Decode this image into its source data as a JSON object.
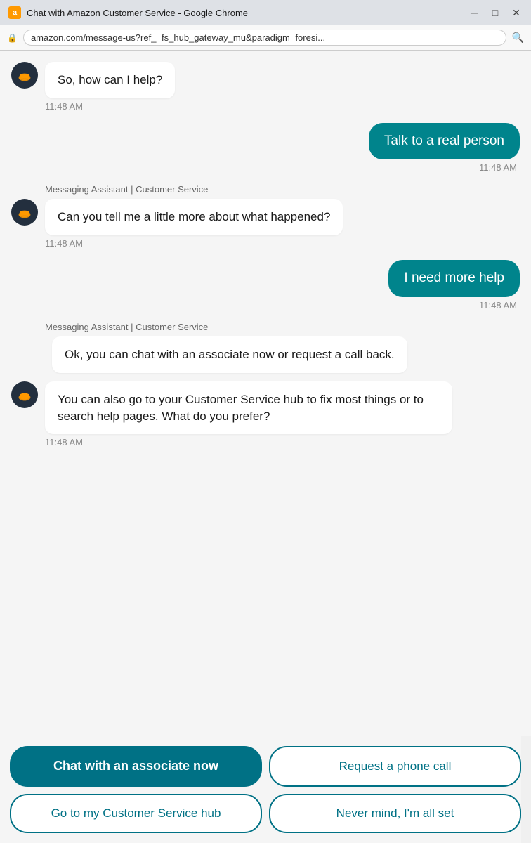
{
  "window": {
    "title": "Chat with Amazon Customer Service - Google Chrome",
    "url": "amazon.com/message-us?ref_=fs_hub_gateway_mu&paradigm=foresi..."
  },
  "titlebar": {
    "icon_label": "a",
    "minimize": "─",
    "maximize": "□",
    "close": "✕"
  },
  "messages": [
    {
      "id": "msg1",
      "type": "bot",
      "text": "So, how can I help?",
      "timestamp": "11:48 AM",
      "show_avatar": true,
      "show_assistant_label": false
    },
    {
      "id": "msg2",
      "type": "user",
      "text": "Talk to a real person",
      "timestamp": "11:48 AM"
    },
    {
      "id": "msg3",
      "type": "bot",
      "text": "Can you tell me a little more about what happened?",
      "timestamp": "11:48 AM",
      "show_avatar": true,
      "show_assistant_label": true,
      "assistant_label": "Messaging Assistant | Customer Service"
    },
    {
      "id": "msg4",
      "type": "user",
      "text": "I need more help",
      "timestamp": "11:48 AM"
    },
    {
      "id": "msg5",
      "type": "bot_multi",
      "bubbles": [
        "Ok, you can chat with an associate now or request a call back.",
        "You can also go to your Customer Service hub to fix most things or to search help pages. What do you prefer?"
      ],
      "timestamp": "11:48 AM",
      "show_avatar": true,
      "show_assistant_label": true,
      "assistant_label": "Messaging Assistant | Customer Service"
    }
  ],
  "buttons": [
    {
      "id": "chat-now",
      "label": "Chat with an associate now",
      "style": "filled"
    },
    {
      "id": "phone-call",
      "label": "Request a phone call",
      "style": "outline"
    },
    {
      "id": "cs-hub",
      "label": "Go to my Customer Service hub",
      "style": "outline"
    },
    {
      "id": "nevermind",
      "label": "Never mind, I'm all set",
      "style": "outline"
    }
  ]
}
